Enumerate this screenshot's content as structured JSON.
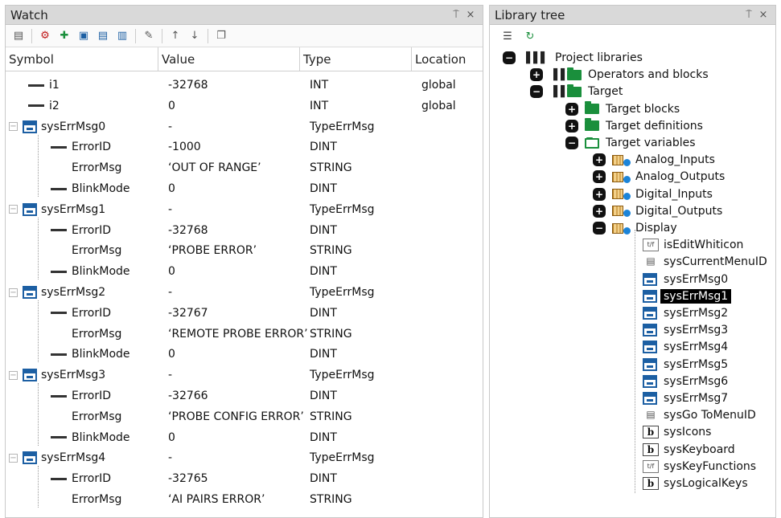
{
  "watch": {
    "title": "Watch",
    "pin": "⍑",
    "close": "×",
    "columns": [
      "Symbol",
      "Value",
      "Type",
      "Location"
    ],
    "rows": [
      {
        "kind": "var",
        "symbol": "i1",
        "value": "-32768",
        "type": "INT",
        "location": "global"
      },
      {
        "kind": "var",
        "symbol": "i2",
        "value": "0",
        "type": "INT",
        "location": "global"
      },
      {
        "kind": "struct",
        "symbol": "sysErrMsg0",
        "value": "-",
        "type": "TypeErrMsg",
        "location": ""
      },
      {
        "kind": "field",
        "symbol": "ErrorID",
        "value": "-1000",
        "type": "DINT",
        "location": ""
      },
      {
        "kind": "field-plain",
        "symbol": "ErrorMsg",
        "value": "‘OUT OF RANGE’",
        "type": "STRING",
        "location": ""
      },
      {
        "kind": "field",
        "symbol": "BlinkMode",
        "value": "0",
        "type": "DINT",
        "location": ""
      },
      {
        "kind": "struct",
        "symbol": "sysErrMsg1",
        "value": "-",
        "type": "TypeErrMsg",
        "location": ""
      },
      {
        "kind": "field",
        "symbol": "ErrorID",
        "value": "-32768",
        "type": "DINT",
        "location": ""
      },
      {
        "kind": "field-plain",
        "symbol": "ErrorMsg",
        "value": "‘PROBE ERROR’",
        "type": "STRING",
        "location": ""
      },
      {
        "kind": "field",
        "symbol": "BlinkMode",
        "value": "0",
        "type": "DINT",
        "location": ""
      },
      {
        "kind": "struct",
        "symbol": "sysErrMsg2",
        "value": "-",
        "type": "TypeErrMsg",
        "location": ""
      },
      {
        "kind": "field",
        "symbol": "ErrorID",
        "value": "-32767",
        "type": "DINT",
        "location": ""
      },
      {
        "kind": "field-plain",
        "symbol": "ErrorMsg",
        "value": "‘REMOTE PROBE ERROR’",
        "type": "STRING",
        "location": ""
      },
      {
        "kind": "field",
        "symbol": "BlinkMode",
        "value": "0",
        "type": "DINT",
        "location": ""
      },
      {
        "kind": "struct",
        "symbol": "sysErrMsg3",
        "value": "-",
        "type": "TypeErrMsg",
        "location": ""
      },
      {
        "kind": "field",
        "symbol": "ErrorID",
        "value": "-32766",
        "type": "DINT",
        "location": ""
      },
      {
        "kind": "field-plain",
        "symbol": "ErrorMsg",
        "value": "‘PROBE CONFIG ERROR’",
        "type": "STRING",
        "location": ""
      },
      {
        "kind": "field",
        "symbol": "BlinkMode",
        "value": "0",
        "type": "DINT",
        "location": ""
      },
      {
        "kind": "struct",
        "symbol": "sysErrMsg4",
        "value": "-",
        "type": "TypeErrMsg",
        "location": ""
      },
      {
        "kind": "field",
        "symbol": "ErrorID",
        "value": "-32765",
        "type": "DINT",
        "location": ""
      },
      {
        "kind": "field-plain",
        "symbol": "ErrorMsg",
        "value": "‘AI PAIRS ERROR’",
        "type": "STRING",
        "location": ""
      }
    ]
  },
  "library": {
    "title": "Library tree",
    "pin": "⍑",
    "close": "×",
    "nodes": [
      {
        "level": 0,
        "expander": "minus",
        "icon": "books",
        "label": "Project libraries",
        "selected": false
      },
      {
        "level": 1,
        "expander": "plus",
        "icon": "books-folder",
        "label": "Operators and blocks",
        "selected": false
      },
      {
        "level": 1,
        "expander": "minus",
        "icon": "books-folder-open",
        "label": "Target",
        "selected": false
      },
      {
        "level": 2,
        "expander": "plus",
        "icon": "folder",
        "label": "Target blocks",
        "selected": false
      },
      {
        "level": 2,
        "expander": "plus",
        "icon": "folder",
        "label": "Target definitions",
        "selected": false
      },
      {
        "level": 2,
        "expander": "minus",
        "icon": "folder-open",
        "label": "Target variables",
        "selected": false
      },
      {
        "level": 3,
        "expander": "plus",
        "icon": "var-group",
        "label": "Analog_Inputs",
        "selected": false
      },
      {
        "level": 3,
        "expander": "plus",
        "icon": "var-group",
        "label": "Analog_Outputs",
        "selected": false
      },
      {
        "level": 3,
        "expander": "plus",
        "icon": "var-group",
        "label": "Digital_Inputs",
        "selected": false
      },
      {
        "level": 3,
        "expander": "plus",
        "icon": "var-group",
        "label": "Digital_Outputs",
        "selected": false
      },
      {
        "level": 3,
        "expander": "minus",
        "icon": "var-group",
        "label": "Display",
        "selected": false
      },
      {
        "level": 4,
        "expander": "none",
        "icon": "tf",
        "label": "isEditWhiticon",
        "selected": false
      },
      {
        "level": 4,
        "expander": "none",
        "icon": "ptr",
        "label": "sysCurrentMenuID",
        "selected": false
      },
      {
        "level": 4,
        "expander": "none",
        "icon": "struct",
        "label": "sysErrMsg0",
        "selected": false
      },
      {
        "level": 4,
        "expander": "none",
        "icon": "struct",
        "label": "sysErrMsg1",
        "selected": true
      },
      {
        "level": 4,
        "expander": "none",
        "icon": "struct",
        "label": "sysErrMsg2",
        "selected": false
      },
      {
        "level": 4,
        "expander": "none",
        "icon": "struct",
        "label": "sysErrMsg3",
        "selected": false
      },
      {
        "level": 4,
        "expander": "none",
        "icon": "struct",
        "label": "sysErrMsg4",
        "selected": false
      },
      {
        "level": 4,
        "expander": "none",
        "icon": "struct",
        "label": "sysErrMsg5",
        "selected": false
      },
      {
        "level": 4,
        "expander": "none",
        "icon": "struct",
        "label": "sysErrMsg6",
        "selected": false
      },
      {
        "level": 4,
        "expander": "none",
        "icon": "struct",
        "label": "sysErrMsg7",
        "selected": false
      },
      {
        "level": 4,
        "expander": "none",
        "icon": "ptr",
        "label": "sysGo ToMenuID",
        "selected": false
      },
      {
        "level": 4,
        "expander": "none",
        "icon": "b",
        "label": "sysIcons",
        "selected": false
      },
      {
        "level": 4,
        "expander": "none",
        "icon": "b",
        "label": "sysKeyboard",
        "selected": false
      },
      {
        "level": 4,
        "expander": "none",
        "icon": "tf",
        "label": "sysKeyFunctions",
        "selected": false
      },
      {
        "level": 4,
        "expander": "none",
        "icon": "b",
        "label": "sysLogicalKeys",
        "selected": false
      }
    ]
  },
  "icons": {
    "b_letter": "b",
    "tf_glyph": "t/f"
  }
}
